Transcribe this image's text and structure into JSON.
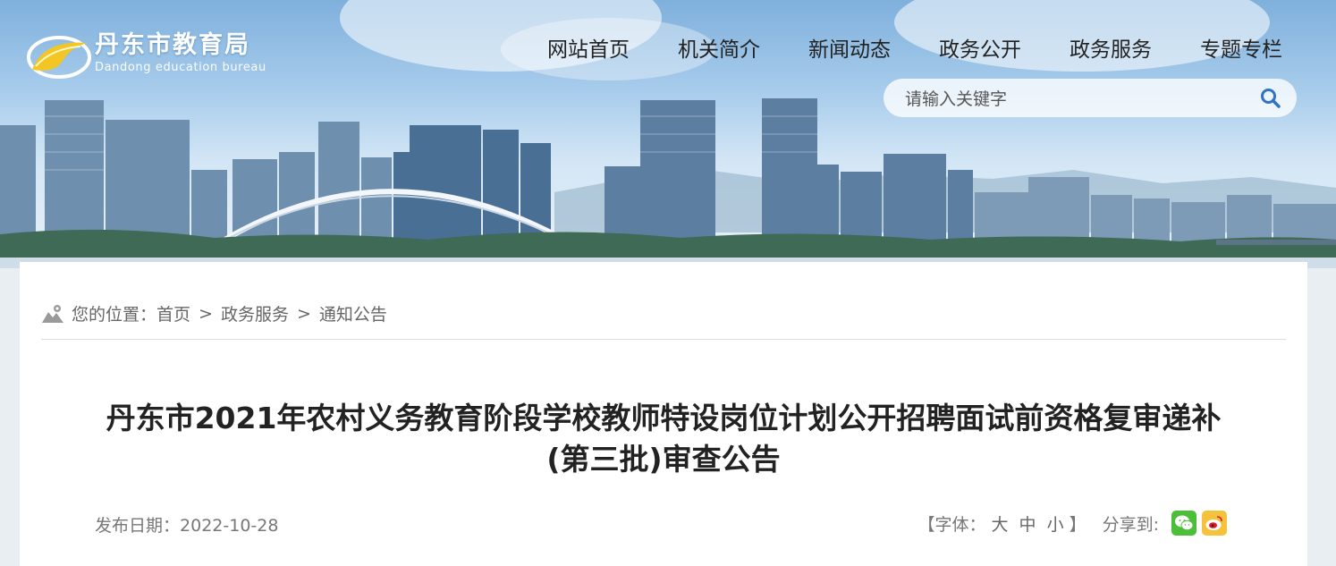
{
  "site": {
    "logo_cn": "丹东市教育局",
    "logo_en": "Dandong education bureau"
  },
  "nav": {
    "items": [
      {
        "label": "网站首页"
      },
      {
        "label": "机关简介"
      },
      {
        "label": "新闻动态"
      },
      {
        "label": "政务公开"
      },
      {
        "label": "政务服务"
      },
      {
        "label": "专题专栏"
      }
    ]
  },
  "search": {
    "placeholder": "请输入关键字",
    "icon": "search-icon"
  },
  "breadcrumb": {
    "prefix": "您的位置：",
    "items": [
      "首页",
      "政务服务",
      "通知公告"
    ],
    "separator": ">"
  },
  "article": {
    "title": "丹东市2021年农村义务教育阶段学校教师特设岗位计划公开招聘面试前资格复审递补(第三批)审查公告",
    "date_label": "发布日期：",
    "date": "2022-10-28"
  },
  "tools": {
    "font_open": "【字体：",
    "font_large": "大",
    "font_medium": "中",
    "font_small": "小",
    "font_close": "】",
    "share_label": "分享到:",
    "share_icons": [
      "wechat-icon",
      "weibo-icon"
    ]
  },
  "colors": {
    "nav_text": "#222222",
    "wechat": "#4cbf38",
    "weibo": "#f5c33b",
    "logo_gold": "#f3c623"
  }
}
